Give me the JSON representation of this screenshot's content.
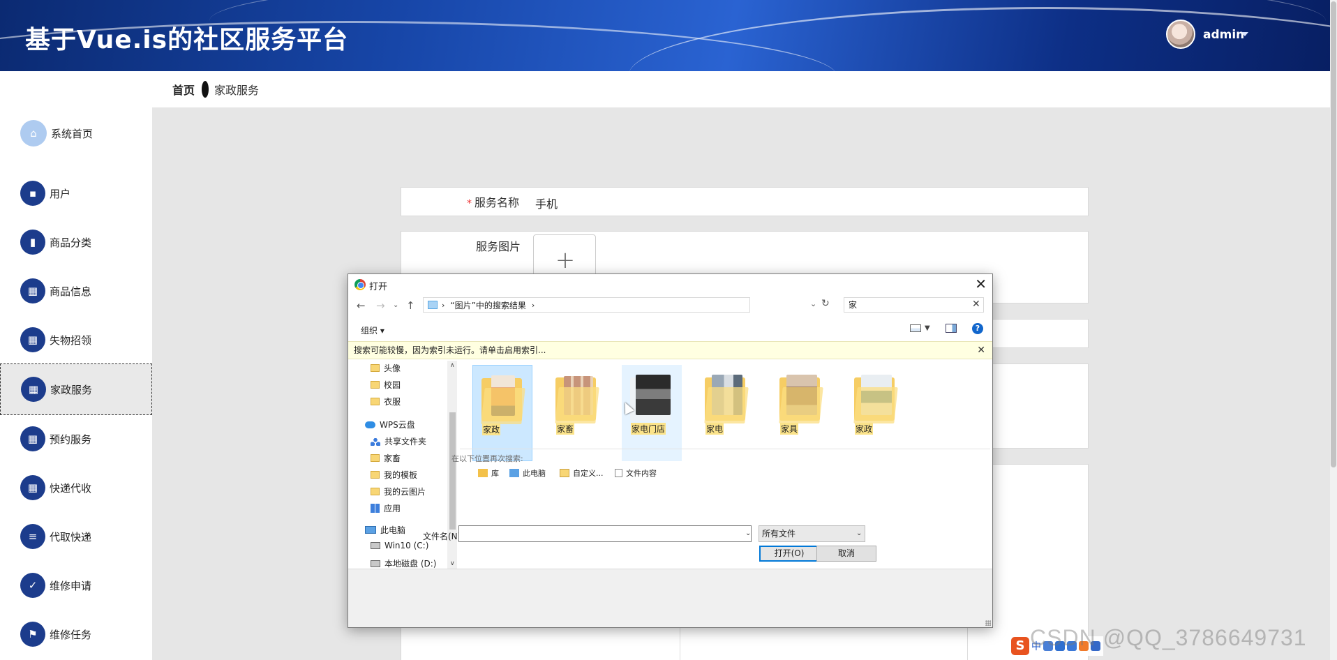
{
  "header": {
    "title": "基于Vue.is的社区服务平台",
    "user": "admin"
  },
  "breadcrumb": {
    "home": "首页",
    "current": "家政服务"
  },
  "sidebar": {
    "items": [
      {
        "label": "系统首页",
        "icon": "home-icon"
      },
      {
        "label": "用户",
        "icon": "chat-icon"
      },
      {
        "label": "商品分类",
        "icon": "trash-icon"
      },
      {
        "label": "商品信息",
        "icon": "grid-icon"
      },
      {
        "label": "失物招领",
        "icon": "grid-icon"
      },
      {
        "label": "家政服务",
        "icon": "grid-icon",
        "active": true
      },
      {
        "label": "预约服务",
        "icon": "grid-icon"
      },
      {
        "label": "快递代收",
        "icon": "grid-icon"
      },
      {
        "label": "代取快递",
        "icon": "list-icon"
      },
      {
        "label": "维修申请",
        "icon": "clipboard-icon"
      },
      {
        "label": "维修任务",
        "icon": "flag-icon"
      }
    ]
  },
  "form": {
    "service_name_label": "服务名称",
    "service_name_value": "手机",
    "service_image_label": "服务图片",
    "upload_plus": "+"
  },
  "dialog": {
    "title": "打开",
    "address": "“图片”中的搜索结果",
    "search_value": "家",
    "organize": "组织",
    "info": "搜索可能较慢，因为索引未运行。请单击启用索引...",
    "tree": [
      "头像",
      "校园",
      "衣服",
      "WPS云盘",
      "共享文件夹",
      "家畜",
      "我的模板",
      "我的云图片",
      "应用",
      "此电脑",
      "Win10 (C:)",
      "本地磁盘 (D:)"
    ],
    "files": [
      {
        "name": "家政",
        "state": "selected"
      },
      {
        "name": "家畜",
        "state": "normal"
      },
      {
        "name": "家电门店",
        "state": "hover"
      },
      {
        "name": "家电",
        "state": "normal"
      },
      {
        "name": "家具",
        "state": "normal"
      },
      {
        "name": "家政",
        "state": "normal"
      }
    ],
    "search_again_label": "在以下位置再次搜索:",
    "search_again": [
      "库",
      "此电脑",
      "自定义...",
      "文件内容"
    ],
    "filename_label": "文件名(N):",
    "filename_value": "",
    "filetype": "所有文件",
    "open_button": "打开(O)",
    "cancel_button": "取消"
  },
  "ime": {
    "label": "中"
  },
  "watermark": "CSDN @QQ_3786649731",
  "colors": {
    "header": "#1746a8",
    "sidebar_icon": "#1c3c8c",
    "accent": "#0078d7",
    "info_bar": "#ffffe1"
  }
}
